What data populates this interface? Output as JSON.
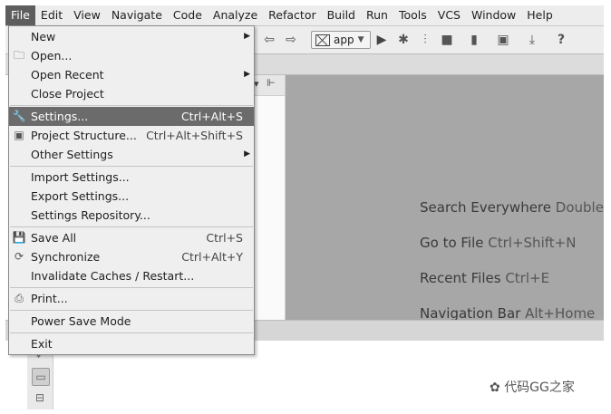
{
  "menubar": {
    "items": [
      {
        "label": "File"
      },
      {
        "label": "Edit"
      },
      {
        "label": "View"
      },
      {
        "label": "Navigate"
      },
      {
        "label": "Code"
      },
      {
        "label": "Analyze"
      },
      {
        "label": "Refactor"
      },
      {
        "label": "Build"
      },
      {
        "label": "Run"
      },
      {
        "label": "Tools"
      },
      {
        "label": "VCS"
      },
      {
        "label": "Window"
      },
      {
        "label": "Help"
      }
    ]
  },
  "toolbar": {
    "run_config": "app"
  },
  "file_menu": {
    "items": [
      {
        "label": "New"
      },
      {
        "label": "Open..."
      },
      {
        "label": "Open Recent"
      },
      {
        "label": "Close Project"
      },
      {
        "label": "Settings...",
        "shortcut": "Ctrl+Alt+S"
      },
      {
        "label": "Project Structure...",
        "shortcut": "Ctrl+Alt+Shift+S"
      },
      {
        "label": "Other Settings"
      },
      {
        "label": "Import Settings..."
      },
      {
        "label": "Export Settings..."
      },
      {
        "label": "Settings Repository..."
      },
      {
        "label": "Save All",
        "shortcut": "Ctrl+S"
      },
      {
        "label": "Synchronize",
        "shortcut": "Ctrl+Alt+Y"
      },
      {
        "label": "Invalidate Caches / Restart..."
      },
      {
        "label": "Print..."
      },
      {
        "label": "Power Save Mode"
      },
      {
        "label": "Exit"
      }
    ]
  },
  "editor_hints": [
    {
      "text": "Search Everywhere",
      "key": "Double"
    },
    {
      "text": "Go to File",
      "key": "Ctrl+Shift+N"
    },
    {
      "text": "Recent Files",
      "key": "Ctrl+E"
    },
    {
      "text": "Navigation Bar",
      "key": "Alt+Home"
    }
  ],
  "watermark": "代码GG之家",
  "colors": {
    "selected_bg": "#6b6b6b",
    "editor_bg": "#a7a7a7",
    "menu_bg": "#efefef"
  }
}
